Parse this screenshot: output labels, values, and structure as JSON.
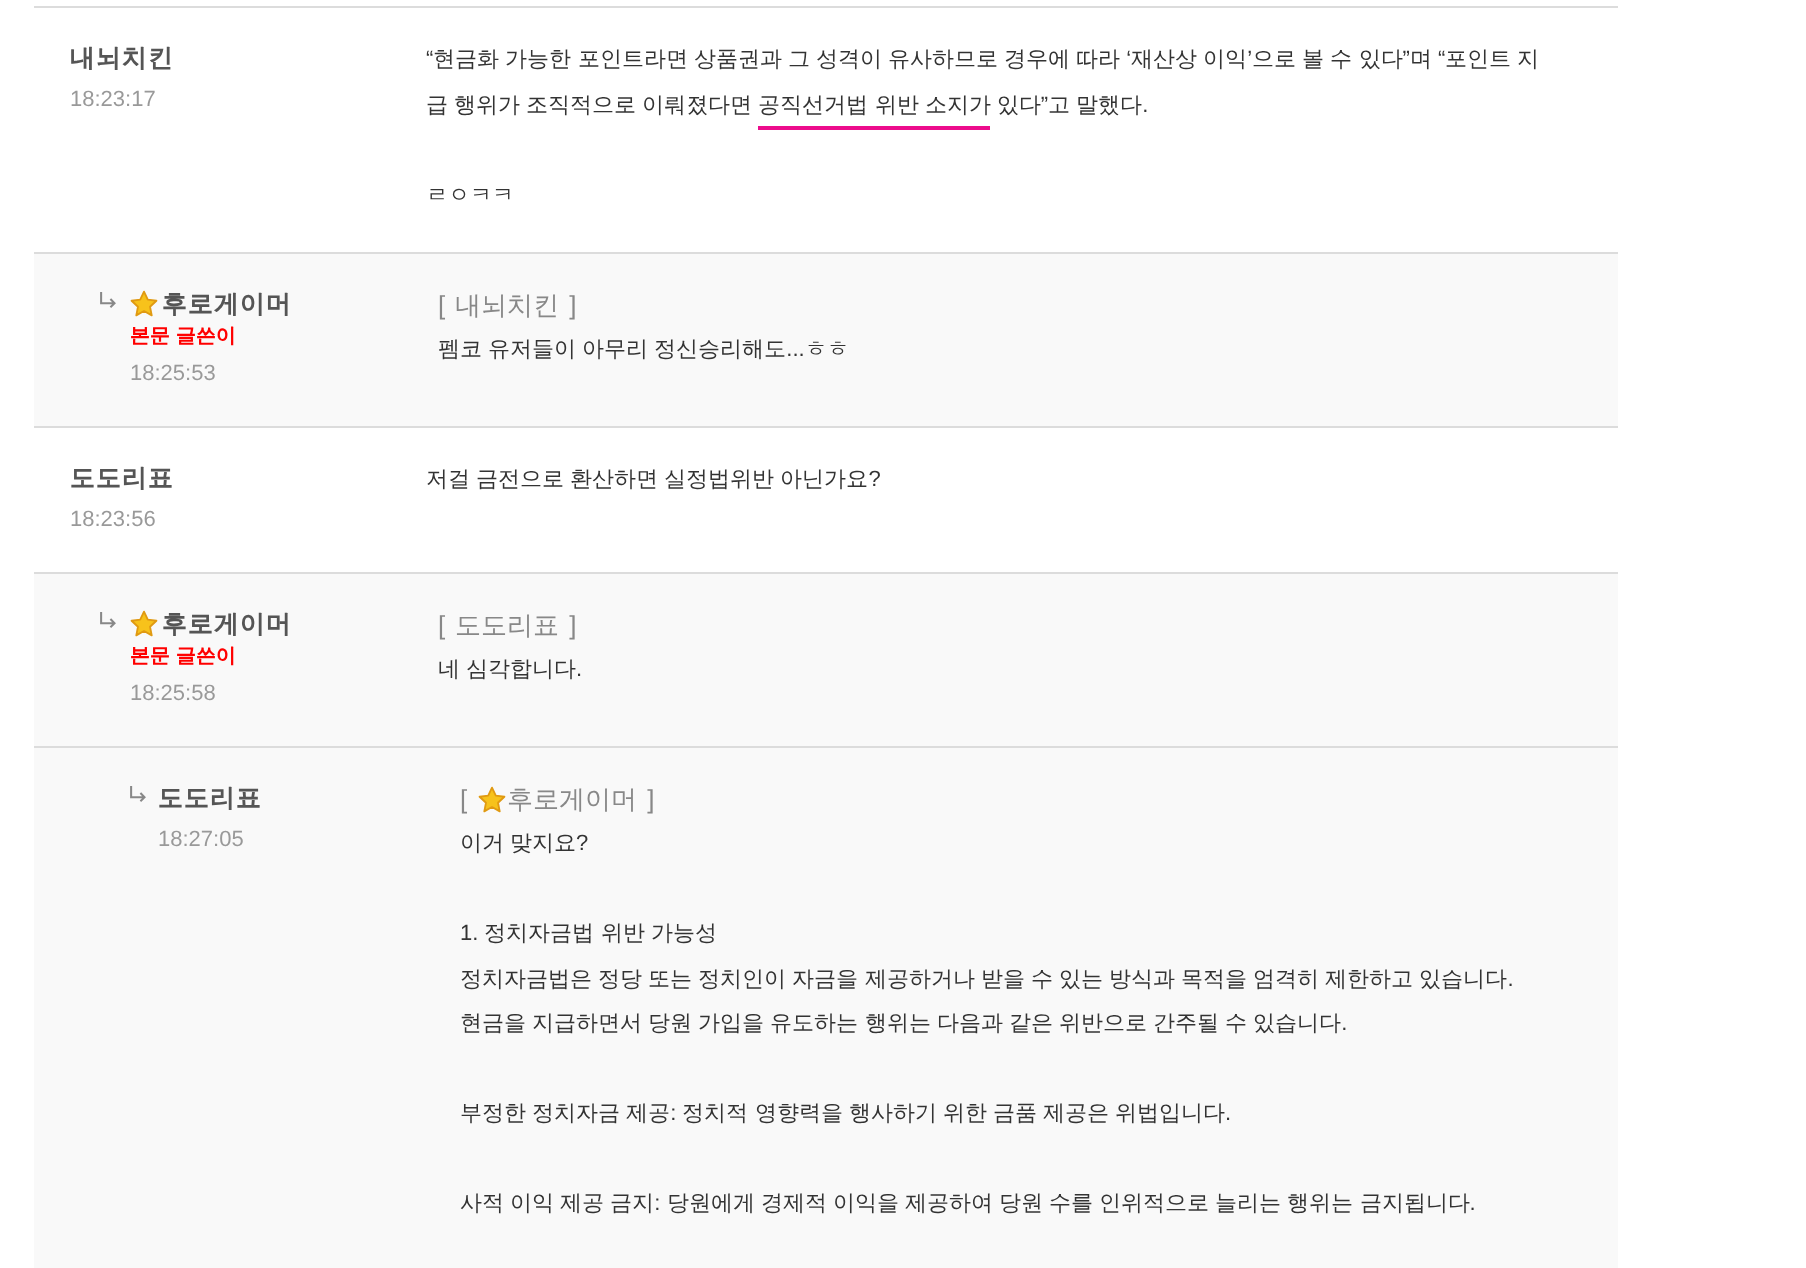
{
  "comments": [
    {
      "author": {
        "name": "내뇌치킨",
        "starred": false
      },
      "time": "18:23:17",
      "body": [
        {
          "kind": "marked",
          "segments": [
            {
              "text": "“현금화 가능한 포인트라면 상품권과 그 성격이 유사하므로 경우에 따라 ‘재산상 이익’으로 볼 수 있다”며 “포인트 지급 행위가 조직적으로 이뤄졌다면 ",
              "pen_underline": false
            },
            {
              "text": "공직선거법 위반 소지가",
              "pen_underline": true
            },
            {
              "text": " 있다”고 말했다.",
              "pen_underline": false
            }
          ]
        },
        {
          "kind": "plain",
          "lines": [
            "ㄹㅇㅋㅋ"
          ]
        }
      ],
      "children": [
        {
          "author": {
            "name": "후로게이머",
            "starred": true,
            "badge": "본문 글쓴이"
          },
          "time": "18:25:53",
          "reply_to": {
            "open": "[",
            "name": "내뇌치킨",
            "starred": false,
            "close": "]"
          },
          "body": [
            {
              "kind": "plain",
              "lines": [
                "펨코 유저들이 아무리 정신승리해도...ㅎㅎ"
              ]
            }
          ]
        }
      ]
    },
    {
      "author": {
        "name": "도도리표",
        "starred": false
      },
      "time": "18:23:56",
      "body": [
        {
          "kind": "plain",
          "lines": [
            "저걸 금전으로 환산하면 실정법위반 아닌가요?"
          ]
        }
      ],
      "children": [
        {
          "author": {
            "name": "후로게이머",
            "starred": true,
            "badge": "본문 글쓴이"
          },
          "time": "18:25:58",
          "reply_to": {
            "open": "[",
            "name": "도도리표",
            "starred": false,
            "close": "]"
          },
          "body": [
            {
              "kind": "plain",
              "lines": [
                "네 심각합니다."
              ]
            }
          ],
          "children": [
            {
              "author": {
                "name": "도도리표",
                "starred": false
              },
              "time": "18:27:05",
              "reply_to": {
                "open": "[",
                "name": "후로게이머",
                "starred": true,
                "close": "]"
              },
              "body": [
                {
                  "kind": "plain",
                  "lines": [
                    "이거 맞지요?"
                  ]
                },
                {
                  "kind": "plain",
                  "lines": [
                    "1. 정치자금법 위반 가능성",
                    "정치자금법은 정당 또는 정치인이 자금을 제공하거나 받을 수 있는 방식과 목적을 엄격히 제한하고 있습니다.",
                    "현금을 지급하면서 당원 가입을 유도하는 행위는 다음과 같은 위반으로 간주될 수 있습니다."
                  ]
                },
                {
                  "kind": "plain",
                  "lines": [
                    "부정한 정치자금 제공: 정치적 영향력을 행사하기 위한 금품 제공은 위법입니다."
                  ]
                },
                {
                  "kind": "plain",
                  "lines": [
                    "사적 이익 제공 금지: 당원에게 경제적 이익을 제공하여 당원 수를 인위적으로 늘리는 행위는 금지됩니다."
                  ]
                }
              ]
            }
          ]
        }
      ]
    }
  ]
}
